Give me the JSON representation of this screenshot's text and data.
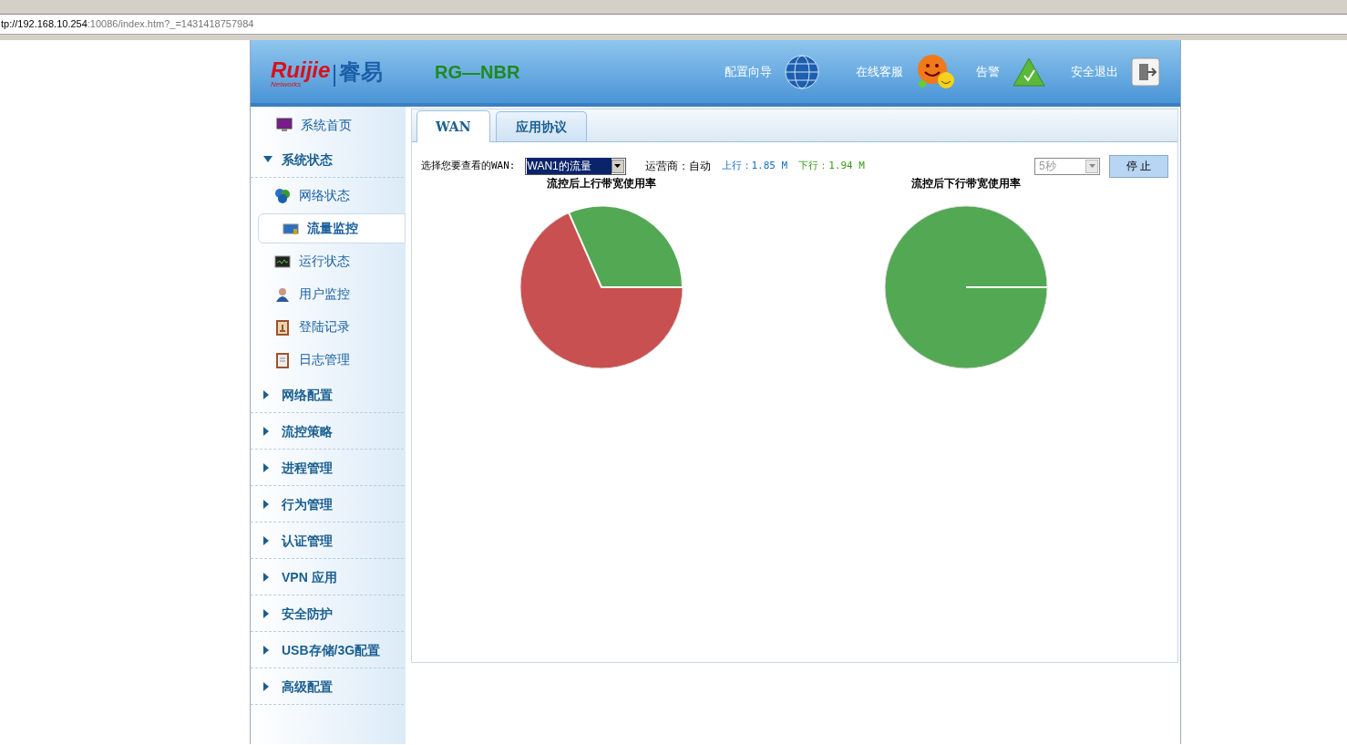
{
  "browser": {
    "address_host": "tp://192.168.10.254",
    "address_rest": ":10086/index.htm?_=1431418757984"
  },
  "header": {
    "logo": "Ruijie",
    "logo_sub": "Networks",
    "logo_cn": "睿易",
    "product": "RG—NBR",
    "actions": [
      "配置向导",
      "在线客服",
      "告警",
      "安全退出"
    ]
  },
  "sidebar": [
    {
      "kind": "link",
      "label": "系统首页"
    },
    {
      "kind": "group",
      "label": "系统状态",
      "expanded": true,
      "children": [
        {
          "label": "网络状态",
          "selected": false
        },
        {
          "label": "流量监控",
          "selected": true
        },
        {
          "label": "运行状态",
          "selected": false
        },
        {
          "label": "用户监控",
          "selected": false
        },
        {
          "label": "登陆记录",
          "selected": false
        },
        {
          "label": "日志管理",
          "selected": false
        }
      ]
    },
    {
      "kind": "group",
      "label": "网络配置",
      "expanded": false
    },
    {
      "kind": "group",
      "label": "流控策略",
      "expanded": false
    },
    {
      "kind": "group",
      "label": "进程管理",
      "expanded": false
    },
    {
      "kind": "group",
      "label": "行为管理",
      "expanded": false
    },
    {
      "kind": "group",
      "label": "认证管理",
      "expanded": false
    },
    {
      "kind": "group",
      "label": "VPN 应用",
      "expanded": false
    },
    {
      "kind": "group",
      "label": "安全防护",
      "expanded": false
    },
    {
      "kind": "group",
      "label": "USB存储/3G配置",
      "expanded": false
    },
    {
      "kind": "group",
      "label": "高级配置",
      "expanded": false
    }
  ],
  "tabs": [
    {
      "label": "WAN",
      "selected": true
    },
    {
      "label": "应用协议",
      "selected": false
    }
  ],
  "toolbar": {
    "wan_label": "选择您要查看的WAN:",
    "wan_select": "WAN1的流量",
    "carrier": "运营商：自动",
    "upstream": "上行：1.85 M",
    "downstream": "下行：1.94 M",
    "interval": {
      "value": "5秒",
      "disabled": true
    },
    "stop_button": "停 止"
  },
  "charts": [
    {
      "title": "流控后上行带宽使用率"
    },
    {
      "title": "流控后下行带宽使用率"
    }
  ]
}
